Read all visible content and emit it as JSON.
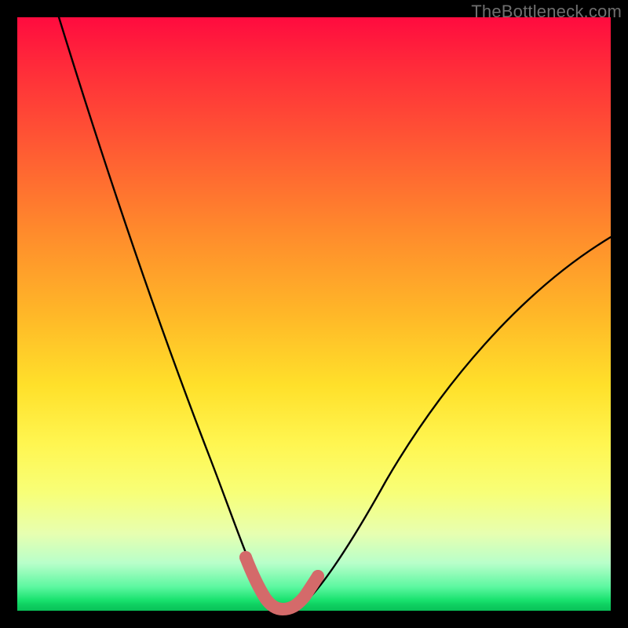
{
  "watermark": "TheBottleneck.com",
  "chart_data": {
    "type": "line",
    "title": "",
    "xlabel": "",
    "ylabel": "",
    "xlim": [
      0,
      100
    ],
    "ylim": [
      0,
      100
    ],
    "grid": false,
    "series": [
      {
        "name": "bottleneck-curve",
        "x": [
          7,
          10,
          14,
          18,
          22,
          26,
          30,
          33,
          35,
          37,
          38.5,
          40,
          42,
          44,
          46,
          47.5,
          49,
          52,
          56,
          62,
          70,
          80,
          90,
          100
        ],
        "y": [
          100,
          92,
          82,
          72,
          62,
          51,
          40,
          30,
          23,
          15,
          9,
          4,
          1,
          0,
          0,
          1,
          3,
          8,
          15,
          24,
          35,
          46,
          55,
          62
        ]
      },
      {
        "name": "optimal-range-marker",
        "x": [
          38.5,
          39,
          40,
          41,
          42,
          43,
          44,
          45,
          46,
          47,
          47.5,
          48,
          49
        ],
        "y": [
          9,
          6.5,
          4,
          2.2,
          1,
          0.3,
          0,
          0.3,
          1,
          1.8,
          2.5,
          3.5,
          5
        ]
      }
    ],
    "background_gradient": {
      "top": "#ff0b3f",
      "mid": "#ffe02a",
      "bottom": "#19e26e"
    }
  }
}
